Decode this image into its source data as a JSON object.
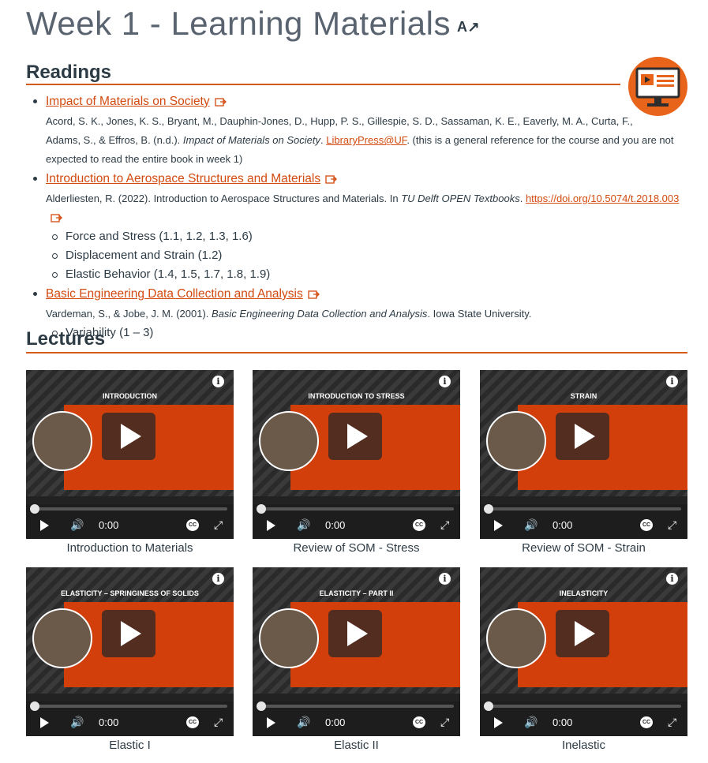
{
  "page": {
    "title": "Week 1 - Learning Materials",
    "title_icon": "text-size-icon"
  },
  "readings": {
    "heading": "Readings",
    "items": [
      {
        "link": "Impact of Materials on Society",
        "cite_1": "Acord, S. K., Jones, K. S., Bryant, M., Dauphin-Jones, D., Hupp, P. S., Gillespie, S. D., Sassaman, K. E., Eaverly, M. A., Curta, F.,",
        "cite_2a": "Adams, S., & Effros, B. (n.d.). ",
        "cite_2b": "Impact of Materials on Society",
        "cite_2c": ". ",
        "cite_link": "LibraryPress@UF",
        "cite_2d": ".  (this is a general reference for the course and you are not",
        "cite_3": "expected to read the entire book in week 1)"
      },
      {
        "link": "Introduction to Aerospace Structures and Materials",
        "cite_a": "Alderliesten, R. (2022). Introduction to Aerospace Structures and Materials. In ",
        "cite_b": "TU Delft OPEN Textbooks",
        "cite_c": ". ",
        "cite_link": "https://doi.org/10.5074/t.2018.003",
        "sub": [
          "Force and Stress (1.1, 1.2, 1.3, 1.6)",
          "Displacement and Strain (1.2)",
          "Elastic Behavior (1.4, 1.5, 1.7, 1.8, 1.9)"
        ]
      },
      {
        "link": "Basic Engineering Data Collection and Analysis",
        "cite_a": "Vardeman, S., & Jobe, J. M. (2001). ",
        "cite_b": "Basic Engineering Data Collection and Analysis",
        "cite_c": ". Iowa State University.",
        "sub": [
          "Variability (1 – 3)"
        ]
      }
    ]
  },
  "lectures": {
    "heading": "Lectures",
    "videos": [
      {
        "slide_title": "INTRODUCTION",
        "time": "0:00",
        "caption": "Introduction to Materials"
      },
      {
        "slide_title": "INTRODUCTION TO STRESS",
        "time": "0:00",
        "caption": "Review of SOM - Stress"
      },
      {
        "slide_title": "STRAIN",
        "time": "0:00",
        "caption": "Review of SOM - Strain"
      },
      {
        "slide_title": "ELASTICITY – SPRINGINESS OF SOLIDS",
        "time": "0:00",
        "caption": "Elastic I"
      },
      {
        "slide_title": "ELASTICITY – PART II",
        "time": "0:00",
        "caption": "Elastic II"
      },
      {
        "slide_title": "INELASTICITY",
        "time": "0:00",
        "caption": "Inelastic"
      }
    ]
  },
  "colors": {
    "accent": "#d24a0f",
    "rule": "#d35b16",
    "badge": "#e8641b",
    "slide_panel": "#d23f0b"
  }
}
